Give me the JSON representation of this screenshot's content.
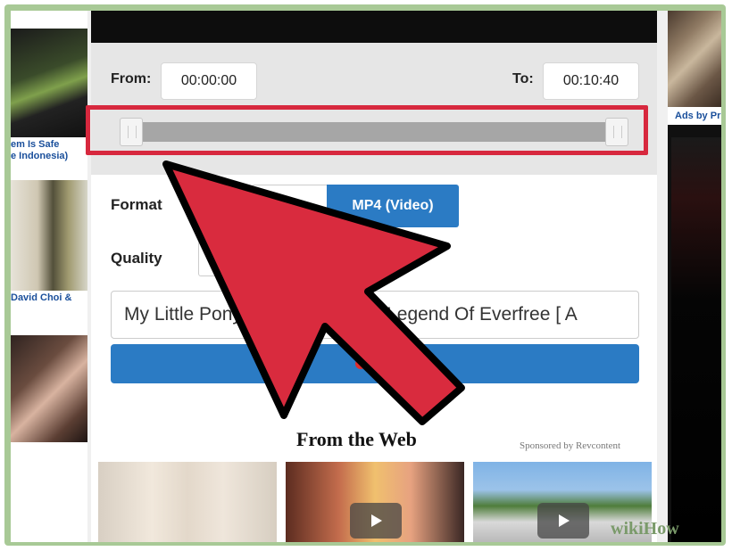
{
  "colors": {
    "frame": "#a8c996",
    "accent_blue": "#2b7bc4",
    "highlight_red": "#d7283e",
    "arrow_red": "#d92b3e"
  },
  "left_column": {
    "captions": [
      "em Is Safe",
      "e Indonesia)",
      "David Choi &"
    ]
  },
  "range": {
    "from_label": "From:",
    "from_value": "00:00:00",
    "to_label": "To:",
    "to_value": "00:10:40"
  },
  "form": {
    "format_label": "Format",
    "format_selected": "MP4 (Video)",
    "quality_label": "Quality",
    "title_value": "My Little Pony Equestria Girls - Legend Of Everfree [ A",
    "record_label": "Re"
  },
  "web_section": {
    "title": "From the Web",
    "sponsored": "Sponsored by Revcontent"
  },
  "right_column": {
    "ads_label": "Ads by Pr"
  },
  "icons": {
    "play": "play-icon",
    "record": "record-dot-icon",
    "arrow": "pointer-arrow-icon"
  },
  "watermark": "wikiHow"
}
